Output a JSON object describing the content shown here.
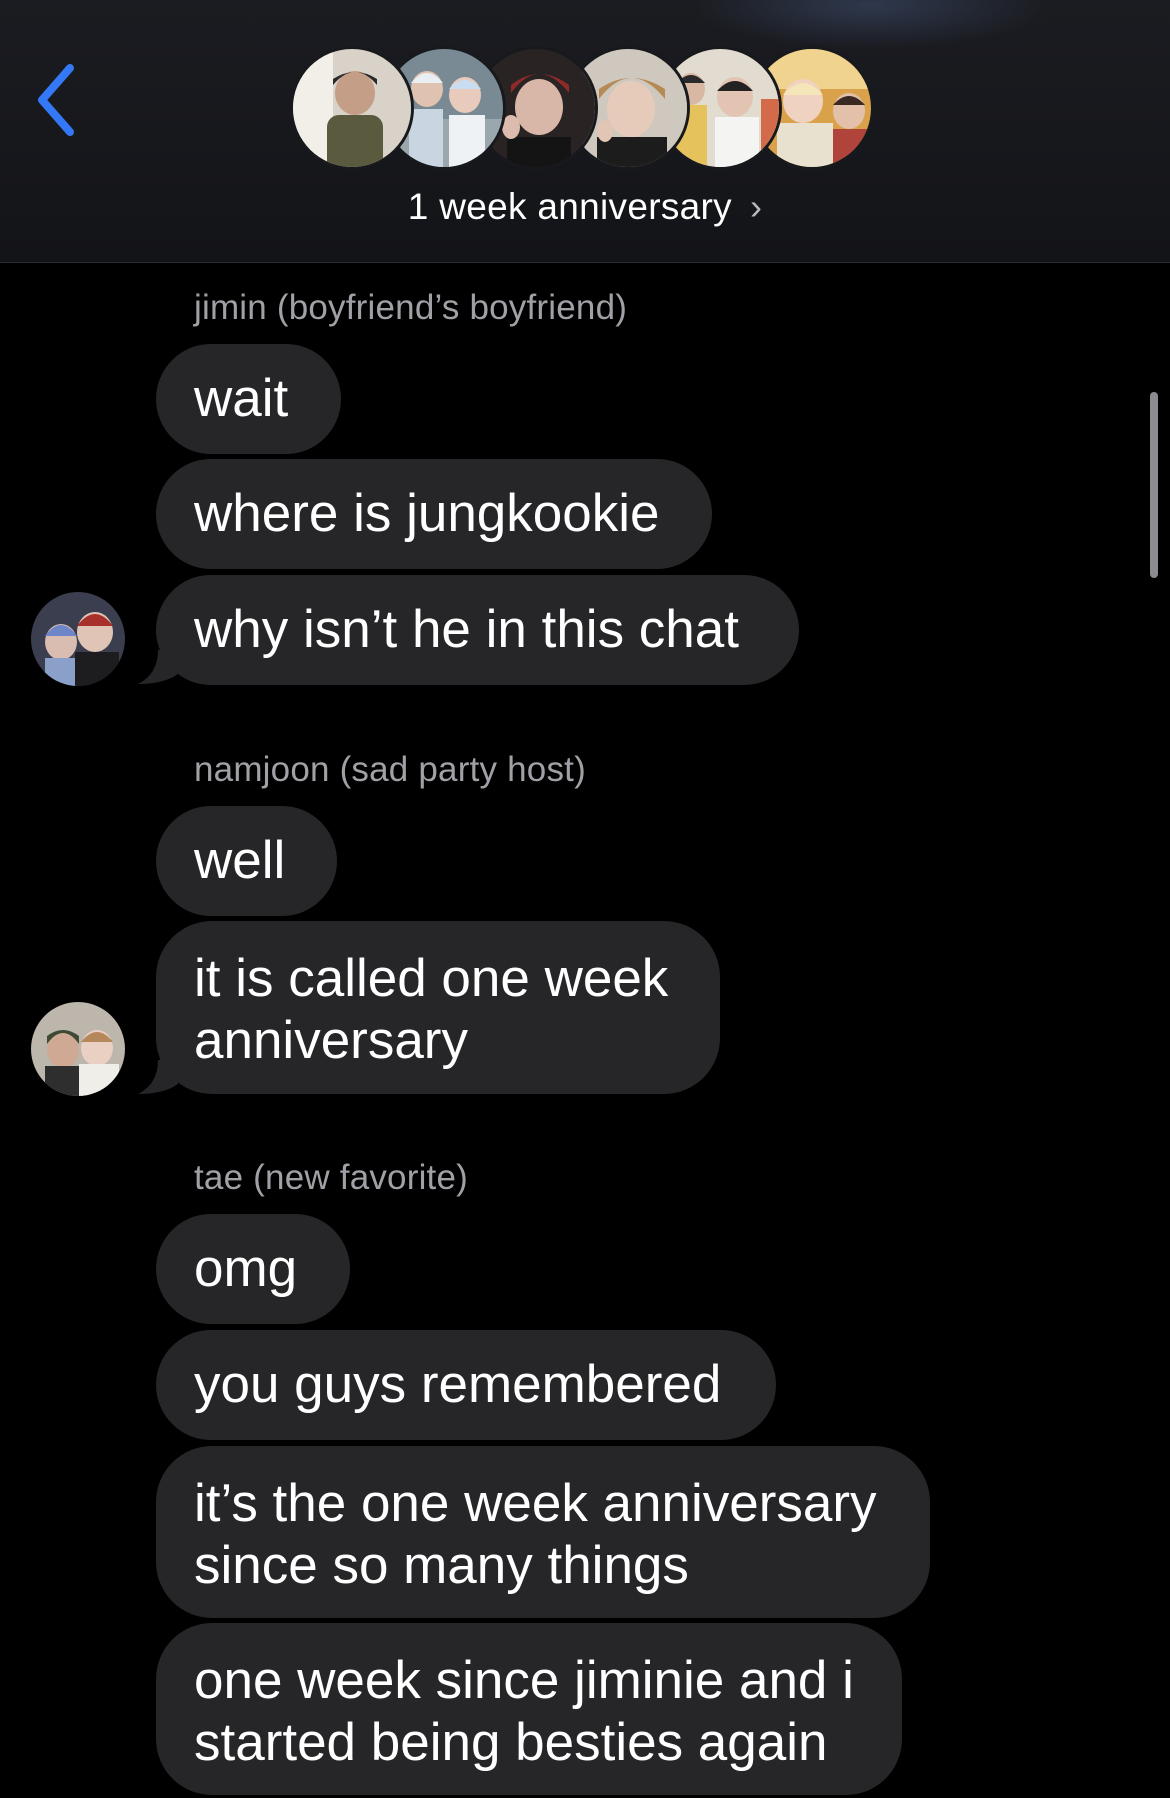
{
  "header": {
    "group_name": "1 week anniversary",
    "chevron": "›",
    "back_icon": "chevron-left-icon",
    "accent_color": "#3478f6"
  },
  "groups": [
    {
      "sender": "jimin (boyfriend’s boyfriend)",
      "messages": [
        "wait",
        "where is jungkookie",
        "why isn’t he in this chat"
      ]
    },
    {
      "sender": "namjoon (sad party host)",
      "messages": [
        "well",
        "it is called one week anniversary"
      ]
    },
    {
      "sender": "tae (new favorite)",
      "messages": [
        "omg",
        "you guys remembered",
        "it’s the one week anniversary since so many things",
        "one week since jiminie and i started being besties again"
      ]
    }
  ],
  "colors": {
    "bubble": "#262629",
    "sender_name": "#a0a0a6",
    "background": "#000000"
  }
}
